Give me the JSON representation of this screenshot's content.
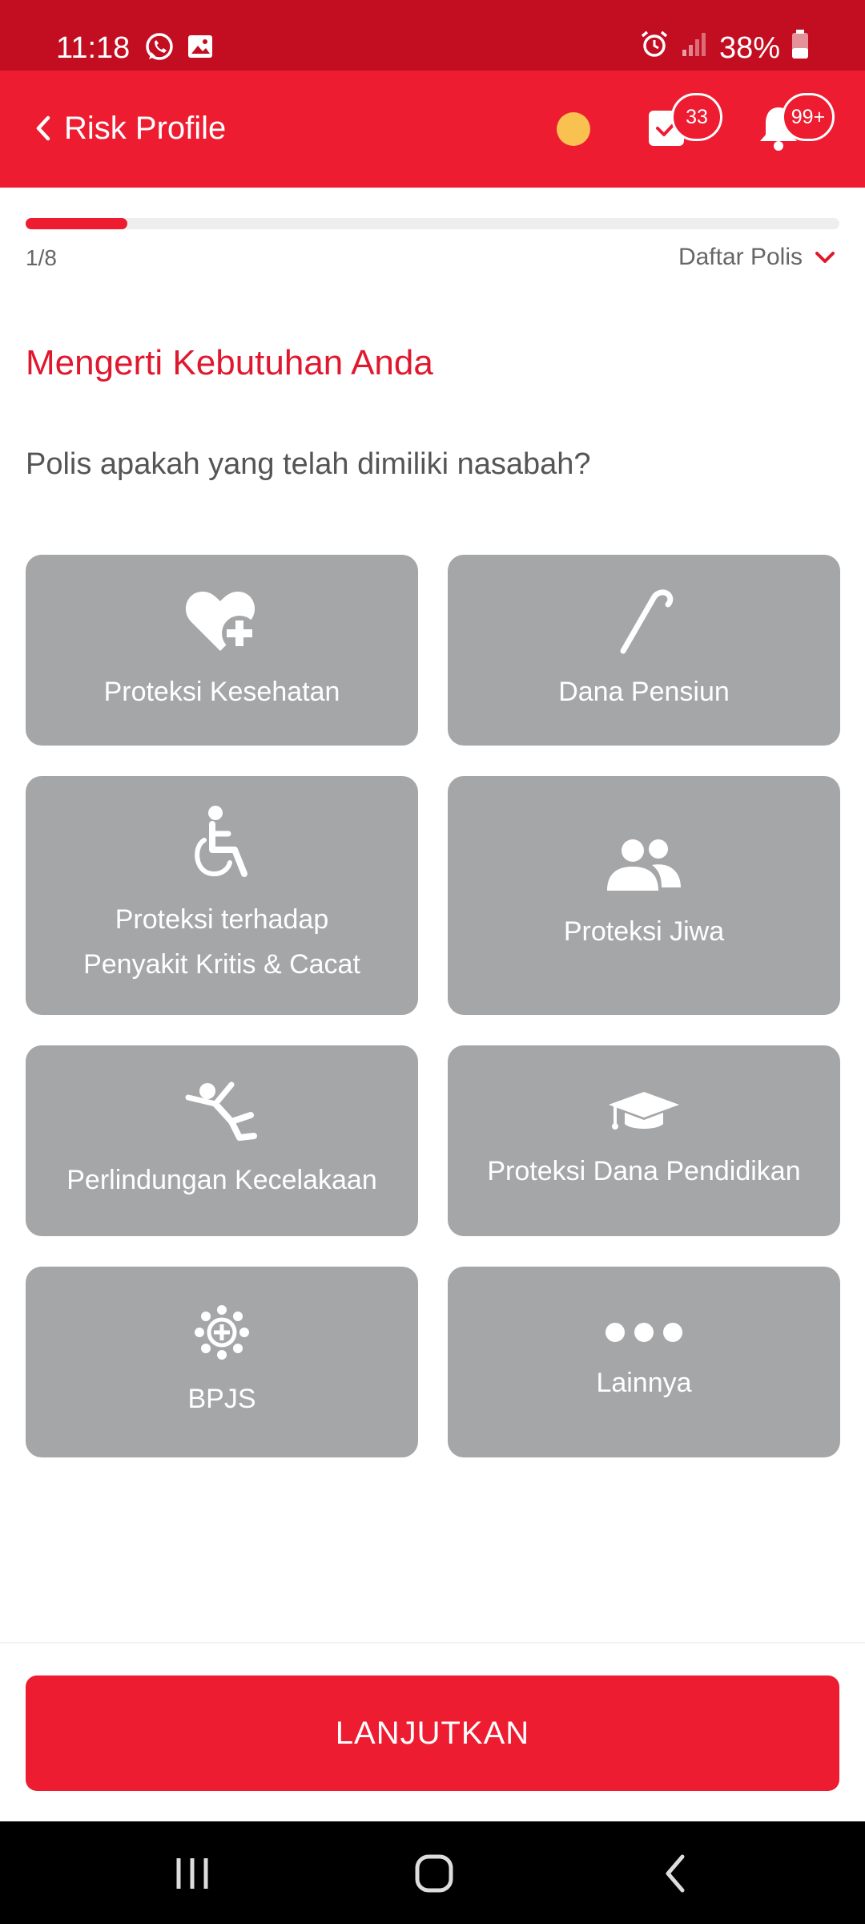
{
  "status_bar": {
    "time": "11:18",
    "battery": "38%",
    "icons": [
      "whatsapp-icon",
      "gallery-icon",
      "alarm-icon",
      "signal-icon",
      "battery-icon"
    ]
  },
  "app_bar": {
    "title": "Risk Profile",
    "tasks_badge": "33",
    "notifications_badge": "99+",
    "colors": {
      "primary": "#ed1c31",
      "status": "#c30d21",
      "dot": "#f9c14f"
    }
  },
  "progress": {
    "step_text": "1/8",
    "fraction": 0.125,
    "policy_list_label": "Daftar Polis"
  },
  "section_title": "Mengerti Kebutuhan Anda",
  "question": "Polis apakah yang telah dimiliki nasabah?",
  "options": [
    {
      "icon": "heart-plus-icon",
      "label": "Proteksi Kesehatan"
    },
    {
      "icon": "cane-icon",
      "label": "Dana Pensiun"
    },
    {
      "icon": "wheelchair-icon",
      "label_lines": [
        "Proteksi terhadap",
        "Penyakit Kritis & Cacat"
      ]
    },
    {
      "icon": "people-icon",
      "label": "Proteksi Jiwa"
    },
    {
      "icon": "falling-person-icon",
      "label": "Perlindungan Kecelakaan"
    },
    {
      "icon": "graduation-cap-icon",
      "label": "Proteksi Dana Pendidikan"
    },
    {
      "icon": "bpjs-icon",
      "label": "BPJS"
    },
    {
      "icon": "more-dots-icon",
      "label": "Lainnya"
    }
  ],
  "continue_button": "LANJUTKAN",
  "card_color": "#a5a6a8"
}
